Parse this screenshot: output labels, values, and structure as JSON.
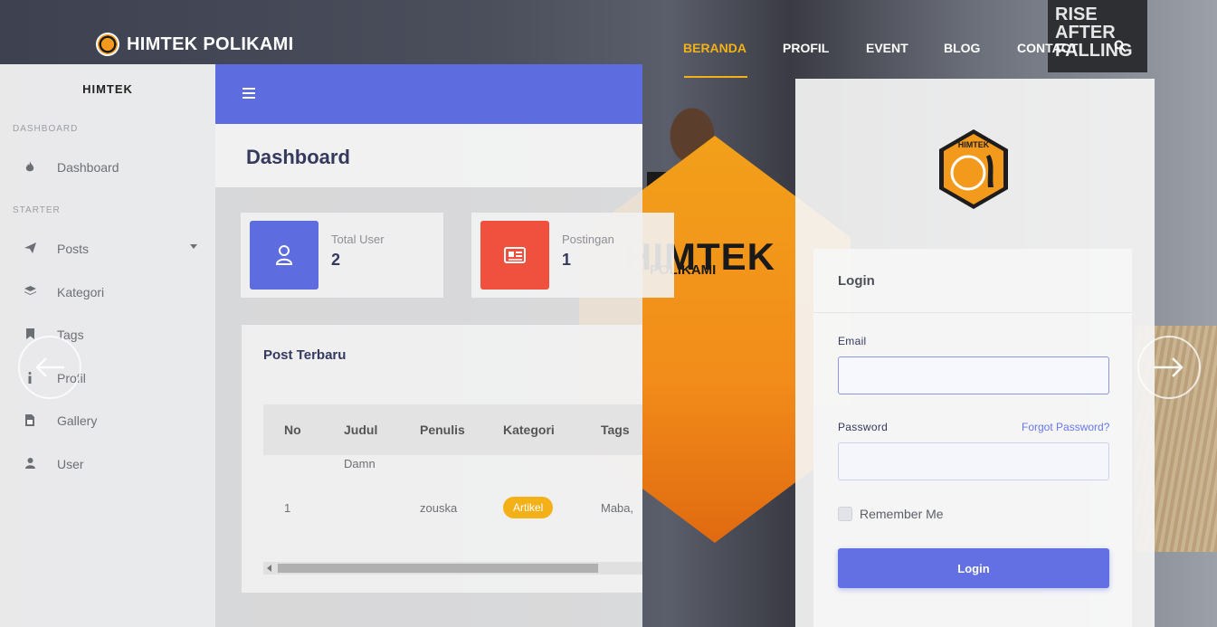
{
  "brand": {
    "name": "HIMTEK POLIKAMI"
  },
  "nav": {
    "items": [
      {
        "label": "BERANDA",
        "active": true
      },
      {
        "label": "PROFIL"
      },
      {
        "label": "EVENT"
      },
      {
        "label": "BLOG"
      },
      {
        "label": "CONTACT"
      }
    ],
    "search_icon": "search-icon",
    "active_color": "#f3b117"
  },
  "background": {
    "poster_text": "HIMTEK",
    "poster_sub": "POLIKAMI",
    "sign_text": "RISE AFTER FALLING"
  },
  "dashboard": {
    "sidebar": {
      "brand": "HIMTEK",
      "sections": [
        {
          "heading": "DASHBOARD",
          "items": [
            {
              "label": "Dashboard",
              "icon": "fire-icon"
            }
          ]
        },
        {
          "heading": "STARTER",
          "items": [
            {
              "label": "Posts",
              "icon": "paper-plane-icon",
              "has_dropdown": true
            },
            {
              "label": "Kategori",
              "icon": "layers-icon"
            },
            {
              "label": "Tags",
              "icon": "bookmark-icon"
            },
            {
              "label": "Profil",
              "icon": "info-icon"
            },
            {
              "label": "Gallery",
              "icon": "image-file-icon"
            },
            {
              "label": "User",
              "icon": "user-icon"
            }
          ]
        }
      ]
    },
    "topbar": {
      "menu_icon": "hamburger-icon",
      "color": "#5d6cdf"
    },
    "title": "Dashboard",
    "stats": [
      {
        "label": "Total User",
        "value": "2",
        "icon": "user-icon",
        "color": "#5d6cdf"
      },
      {
        "label": "Postingan",
        "value": "1",
        "icon": "newspaper-icon",
        "color": "#f0513f"
      }
    ],
    "recent_posts": {
      "title": "Post Terbaru",
      "columns": [
        "No",
        "Judul",
        "Penulis",
        "Kategori",
        "Tags"
      ],
      "rows": [
        {
          "no": "1",
          "judul": "Damn",
          "penulis": "zouska",
          "kategori": "Artikel",
          "tags": "Maba,"
        }
      ]
    }
  },
  "login": {
    "logo_text": "HIMTEK",
    "title": "Login",
    "email_label": "Email",
    "email_value": "",
    "password_label": "Password",
    "forgot_link": "Forgot Password?",
    "remember_label": "Remember Me",
    "submit_label": "Login",
    "accent_color": "#6270e4"
  }
}
